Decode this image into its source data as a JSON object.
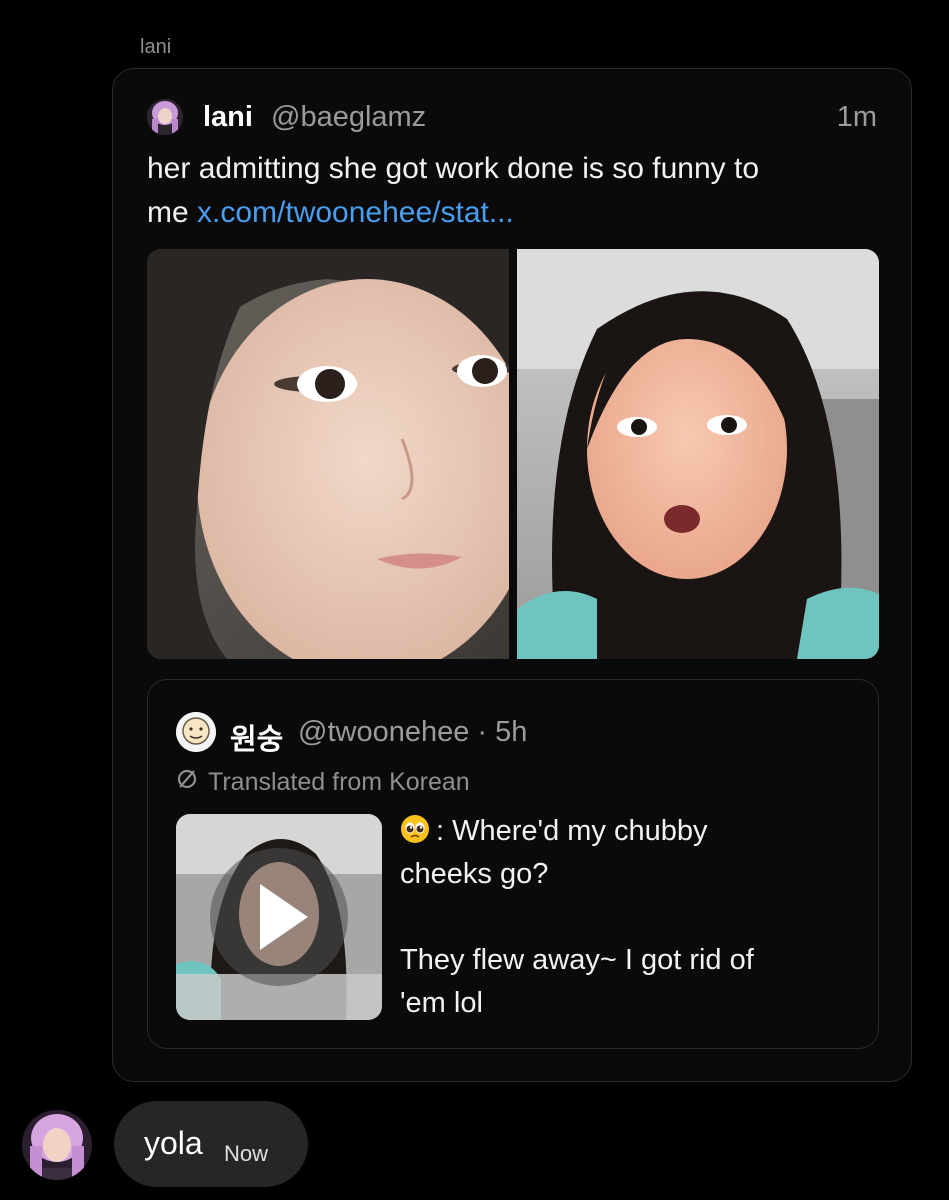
{
  "message": {
    "sender_label": "lani",
    "shared_post": {
      "author_name": "lani",
      "author_handle": "@baeglamz",
      "time": "1m",
      "text_line1": "her admitting she got work done is so funny to",
      "text_line2_prefix": "me ",
      "link_text": "x.com/twoonehee/stat...",
      "media_count": 2,
      "quoted_post": {
        "author_name": "원숭",
        "author_handle_time": "@twoonehee · 5h",
        "translated_label": "Translated from Korean",
        "text_line1": ": Where'd my chubby",
        "text_line2": "cheeks go?",
        "text_line3": "They flew away~ I got rid of",
        "text_line4": "'em lol",
        "has_video": true
      }
    }
  },
  "reply": {
    "text": "yola",
    "time": "Now"
  },
  "colors": {
    "background": "#000000",
    "link": "#4a9eef",
    "bubble": "#262628",
    "muted_text": "#9a9a9f"
  },
  "icons": {
    "play": "play-icon",
    "translate": "slashed-circle-icon",
    "emoji": "pleading-face-emoji"
  }
}
